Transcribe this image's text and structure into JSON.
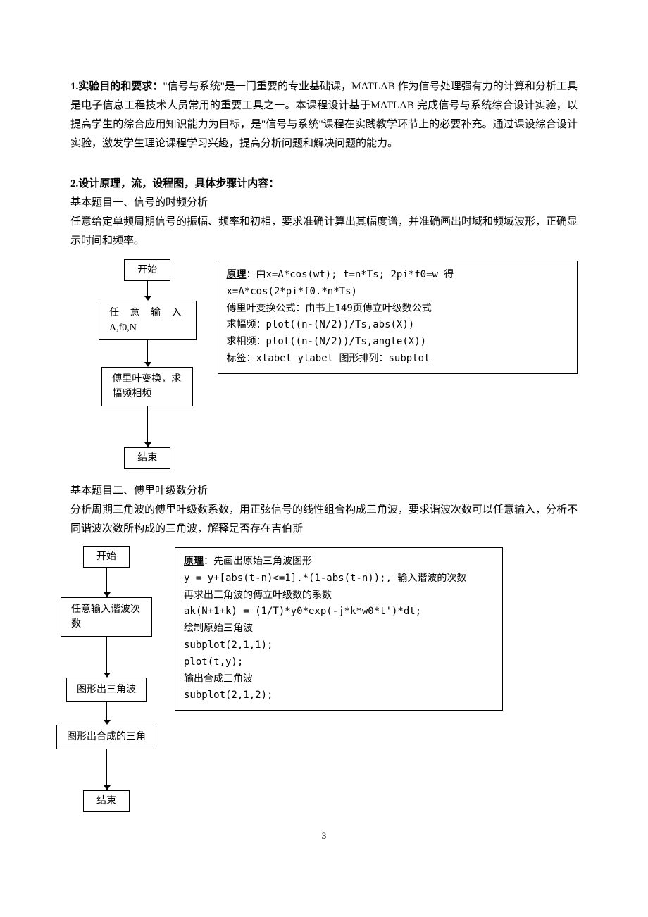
{
  "section1": {
    "heading": "1.实验目的和要求：",
    "body": "\"信号与系统\"是一门重要的专业基础课，MATLAB 作为信号处理强有力的计算和分析工具是电子信息工程技术人员常用的重要工具之一。本课程设计基于MATLAB 完成信号与系统综合设计实验，以提高学生的综合应用知识能力为目标，是\"信号与系统\"课程在实践教学环节上的必要补充。通过课设综合设计实验，激发学生理论课程学习兴趣，提高分析问题和解决问题的能力。"
  },
  "section2": {
    "heading": "2.设计原理，流，设程图，具体步骤计内容：",
    "topic1_title": "基本题目一、信号的时频分析",
    "topic1_desc": "任意给定单频周期信号的振幅、频率和初相，要求准确计算出其幅度谱，并准确画出时域和频域波形，正确显示时间和频率。",
    "flow1": {
      "b1": "开始",
      "b2_l1": "任 意 输 入",
      "b2_l2": "A,f0,N",
      "b3": "傅里叶变换，求幅频相频",
      "b4": "结束"
    },
    "principle1": {
      "label": "原理",
      "text": "：由x=A*cos(wt); t=n*Ts; 2pi*f0=w 得\nx=A*cos(2*pi*f0.*n*Ts)\n傅里叶变换公式：由书上149页傅立叶级数公式\n求幅频：plot((n-(N/2))/Ts,abs(X))\n求相频：plot((n-(N/2))/Ts,angle(X))\n标签：xlabel ylabel 图形排列：subplot"
    },
    "topic2_title": "基本题目二、傅里叶级数分析",
    "topic2_desc": "分析周期三角波的傅里叶级数系数，用正弦信号的线性组合构成三角波，要求谐波次数可以任意输入，分析不同谐波次数所构成的三角波，解释是否存在吉伯斯",
    "flow2": {
      "b1": "开始",
      "b2": "任意输入谐波次数",
      "b3": "图形出三角波",
      "b4": "图形出合成的三角",
      "b5": "结束"
    },
    "principle2": {
      "label": "原理",
      "text": "：先画出原始三角波图形\ny = y+[abs(t-n)<=1].*(1-abs(t-n));, 输入谐波的次数\n再求出三角波的傅立叶级数的系数\nak(N+1+k) = (1/T)*y0*exp(-j*k*w0*t')*dt;\n绘制原始三角波\nsubplot(2,1,1);\nplot(t,y);\n输出合成三角波\nsubplot(2,1,2);"
    }
  },
  "page_number": "3"
}
